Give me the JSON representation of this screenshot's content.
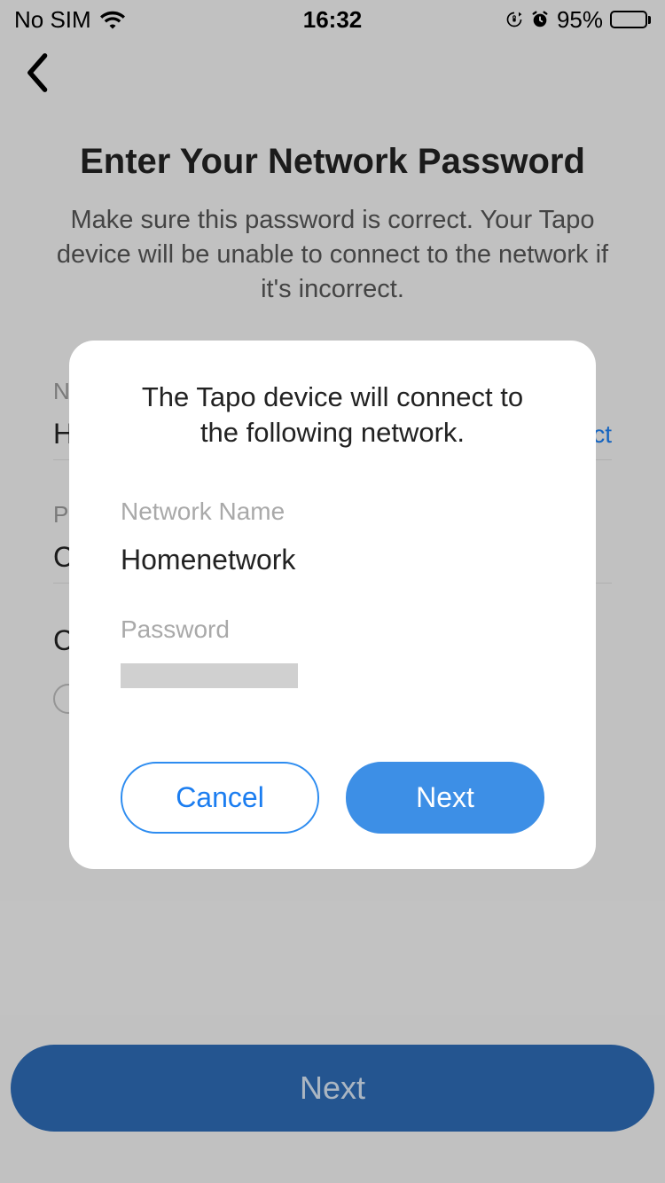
{
  "statusbar": {
    "carrier": "No SIM",
    "time": "16:32",
    "battery_pct": "95%"
  },
  "page": {
    "title": "Enter Your Network Password",
    "subtitle": "Make sure this password is correct. Your Tapo device will be unable to connect to the network if it's incorrect.",
    "network_label": "N",
    "network_value_initial": "H",
    "select_link": "ct",
    "password_label": "P",
    "password_value_initial": "C",
    "checkbox_initial": "C",
    "bottom_next": "Next"
  },
  "dialog": {
    "title": "The Tapo device will connect to the following network.",
    "network_label": "Network Name",
    "network_value": "Homenetwork",
    "password_label": "Password",
    "password_value": "",
    "cancel": "Cancel",
    "next": "Next"
  }
}
